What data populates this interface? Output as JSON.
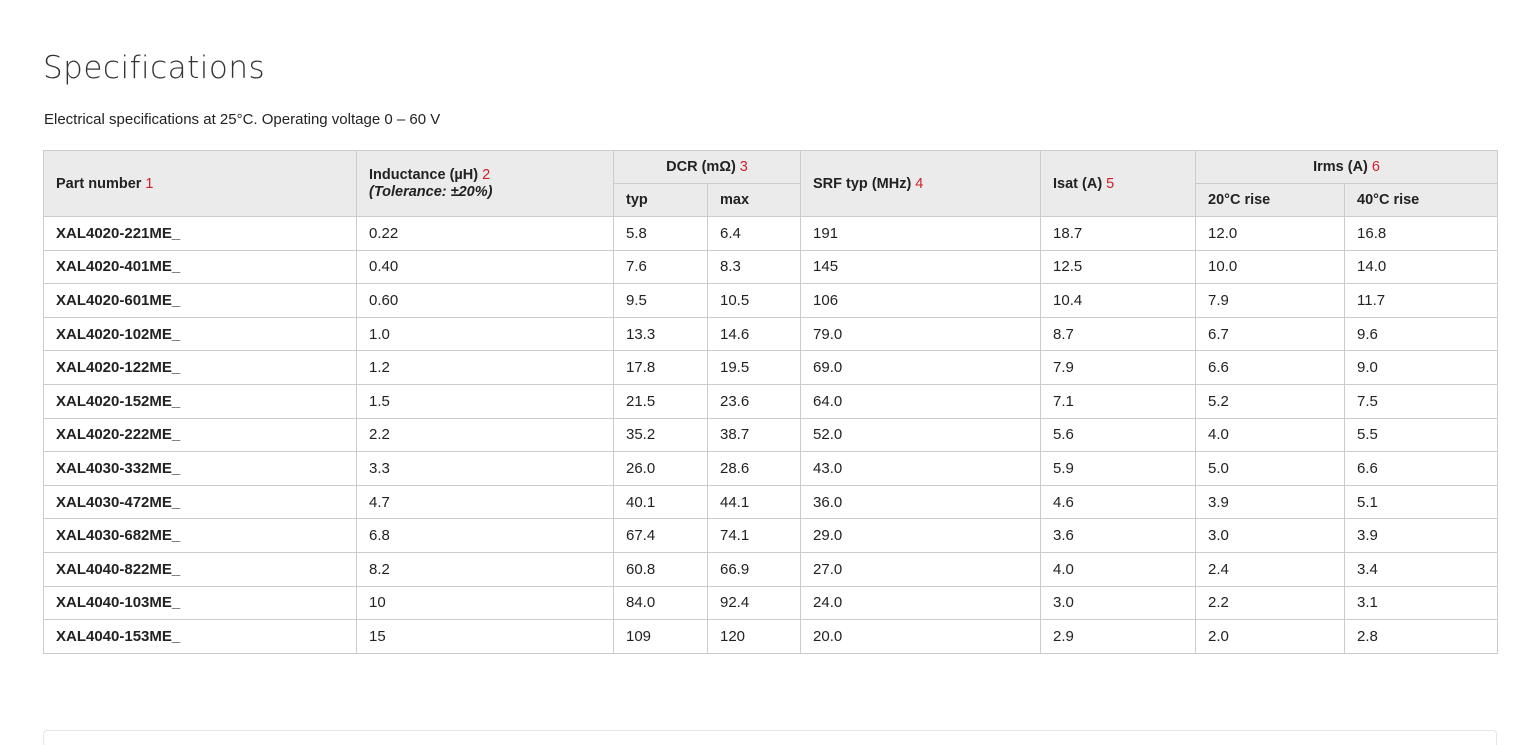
{
  "section": {
    "title": "Specifications",
    "subtitle": "Electrical specifications at 25°C. Operating voltage 0 – 60 V"
  },
  "table": {
    "headers": {
      "part": {
        "label": "Part number",
        "note": "1"
      },
      "inductance": {
        "label": "Inductance (µH)",
        "note": "2",
        "sub": "(Tolerance: ±20%)"
      },
      "dcr": {
        "label": "DCR (mΩ)",
        "note": "3",
        "typ": "typ",
        "max": "max"
      },
      "srf": {
        "label": "SRF typ (MHz)",
        "note": "4"
      },
      "isat": {
        "label": "Isat (A)",
        "note": "5"
      },
      "irms": {
        "label": "Irms (A)",
        "note": "6",
        "rise20": "20°C rise",
        "rise40": "40°C rise"
      }
    },
    "rows": [
      [
        "XAL4020-221ME_",
        "0.22",
        "5.8",
        "6.4",
        "191",
        "18.7",
        "12.0",
        "16.8"
      ],
      [
        "XAL4020-401ME_",
        "0.40",
        "7.6",
        "8.3",
        "145",
        "12.5",
        "10.0",
        "14.0"
      ],
      [
        "XAL4020-601ME_",
        "0.60",
        "9.5",
        "10.5",
        "106",
        "10.4",
        "7.9",
        "11.7"
      ],
      [
        "XAL4020-102ME_",
        "1.0",
        "13.3",
        "14.6",
        "79.0",
        "8.7",
        "6.7",
        "9.6"
      ],
      [
        "XAL4020-122ME_",
        "1.2",
        "17.8",
        "19.5",
        "69.0",
        "7.9",
        "6.6",
        "9.0"
      ],
      [
        "XAL4020-152ME_",
        "1.5",
        "21.5",
        "23.6",
        "64.0",
        "7.1",
        "5.2",
        "7.5"
      ],
      [
        "XAL4020-222ME_",
        "2.2",
        "35.2",
        "38.7",
        "52.0",
        "5.6",
        "4.0",
        "5.5"
      ],
      [
        "XAL4030-332ME_",
        "3.3",
        "26.0",
        "28.6",
        "43.0",
        "5.9",
        "5.0",
        "6.6"
      ],
      [
        "XAL4030-472ME_",
        "4.7",
        "40.1",
        "44.1",
        "36.0",
        "4.6",
        "3.9",
        "5.1"
      ],
      [
        "XAL4030-682ME_",
        "6.8",
        "67.4",
        "74.1",
        "29.0",
        "3.6",
        "3.0",
        "3.9"
      ],
      [
        "XAL4040-822ME_",
        "8.2",
        "60.8",
        "66.9",
        "27.0",
        "4.0",
        "2.4",
        "3.4"
      ],
      [
        "XAL4040-103ME_",
        "10",
        "84.0",
        "92.4",
        "24.0",
        "3.0",
        "2.2",
        "3.1"
      ],
      [
        "XAL4040-153ME_",
        "15",
        "109",
        "120",
        "20.0",
        "2.9",
        "2.0",
        "2.8"
      ]
    ]
  },
  "colors": {
    "note": "#d0202a",
    "header_bg": "#ebebeb",
    "border": "#cccccc"
  }
}
